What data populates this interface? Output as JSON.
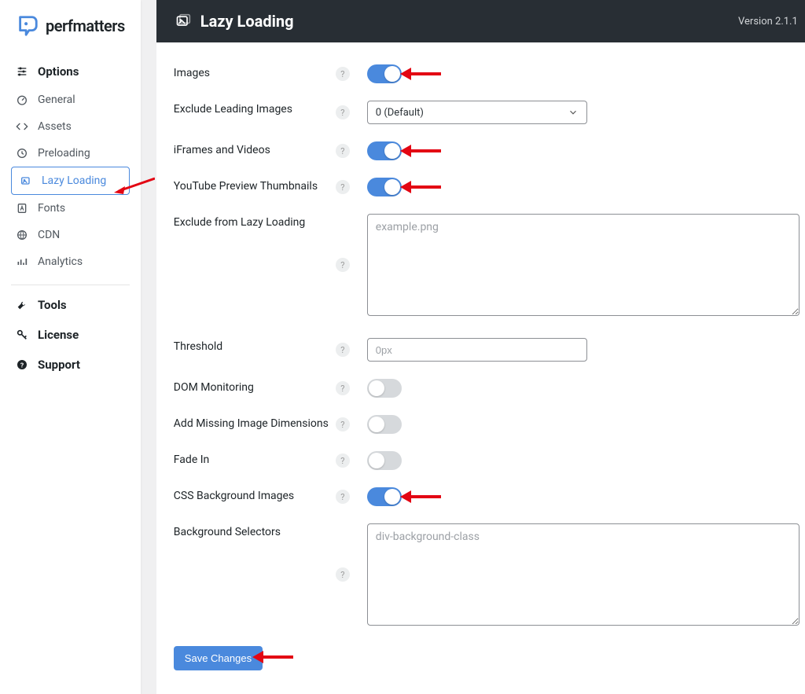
{
  "brand": "perfmatters",
  "version_label": "Version 2.1.1",
  "page_title": "Lazy Loading",
  "sidebar": {
    "section_options": "Options",
    "items": [
      {
        "label": "General"
      },
      {
        "label": "Assets"
      },
      {
        "label": "Preloading"
      },
      {
        "label": "Lazy Loading"
      },
      {
        "label": "Fonts"
      },
      {
        "label": "CDN"
      },
      {
        "label": "Analytics"
      }
    ],
    "tools": "Tools",
    "license": "License",
    "support": "Support"
  },
  "form": {
    "images": {
      "label": "Images",
      "value": true
    },
    "exclude_leading": {
      "label": "Exclude Leading Images",
      "selected": "0 (Default)"
    },
    "iframes": {
      "label": "iFrames and Videos",
      "value": true
    },
    "yt_thumb": {
      "label": "YouTube Preview Thumbnails",
      "value": true
    },
    "exclude_lazy": {
      "label": "Exclude from Lazy Loading",
      "placeholder": "example.png",
      "value": ""
    },
    "threshold": {
      "label": "Threshold",
      "placeholder": "0px",
      "value": ""
    },
    "dom_monitor": {
      "label": "DOM Monitoring",
      "value": false
    },
    "add_dims": {
      "label": "Add Missing Image Dimensions",
      "value": false
    },
    "fade_in": {
      "label": "Fade In",
      "value": false
    },
    "css_bg": {
      "label": "CSS Background Images",
      "value": true
    },
    "bg_selectors": {
      "label": "Background Selectors",
      "placeholder": "div-background-class",
      "value": ""
    },
    "save": "Save Changes"
  }
}
